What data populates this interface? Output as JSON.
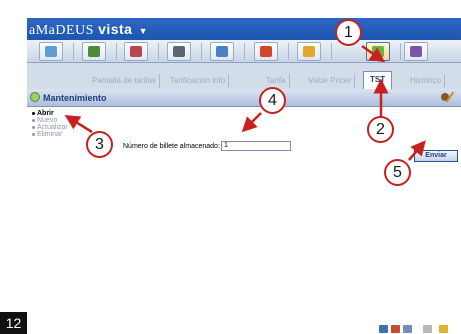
{
  "app": {
    "brand": "aMaDEUS",
    "product": "vista",
    "menu_caret": "▼"
  },
  "toolbar": {
    "buttons": [
      {
        "name": "tool-button-1",
        "glyph_color": "#5f9ed1"
      },
      {
        "name": "tool-button-2",
        "glyph_color": "#4d8b3a"
      },
      {
        "name": "tool-button-3",
        "glyph_color": "#b9474f"
      },
      {
        "name": "tool-button-4",
        "glyph_color": "#5a6578"
      },
      {
        "name": "tool-button-5",
        "glyph_color": "#4b7fc4"
      },
      {
        "name": "tool-button-6",
        "glyph_color": "#d4462b"
      },
      {
        "name": "tool-button-7",
        "glyph_color": "#e6a62c"
      },
      {
        "name": "tool-button-8",
        "glyph_color": "#6cb23d",
        "active": true
      },
      {
        "name": "tool-button-9",
        "glyph_color": "#7b55a8"
      }
    ]
  },
  "tabs": [
    {
      "label": "Pantalla de tarifas",
      "active": false
    },
    {
      "label": "Tarificación info",
      "active": false
    },
    {
      "label": "Tarifa",
      "active": false
    },
    {
      "label": "Value Pricer",
      "active": false
    },
    {
      "label": "TST",
      "active": true
    },
    {
      "label": "Histórico",
      "active": false
    }
  ],
  "section": {
    "title": "Mantenimiento"
  },
  "menu": {
    "items": [
      {
        "label": "Abrir",
        "selected": true
      },
      {
        "label": "Nuevo",
        "selected": false
      },
      {
        "label": "Actualizar",
        "selected": false
      },
      {
        "label": "Eliminar",
        "selected": false
      }
    ]
  },
  "form": {
    "ticket_label": "Número de billete almacenado:",
    "ticket_value": "1"
  },
  "actions": {
    "send_label": "Enviar"
  },
  "callouts": [
    "1",
    "2",
    "3",
    "4",
    "5"
  ],
  "page_number": "12",
  "colors": {
    "callout_border": "#c82020",
    "title_bar": "#2d67c4",
    "app_background": "#c9d4e4"
  }
}
